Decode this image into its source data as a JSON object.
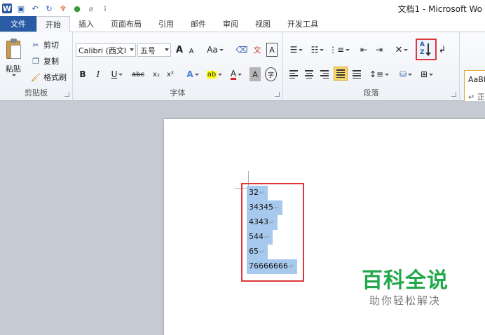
{
  "window": {
    "title": "文档1 - Microsoft Wo",
    "quick_access": [
      "word-app-icon",
      "save-icon",
      "undo-icon",
      "redo-icon",
      "brush-icon",
      "color-icon",
      "eraser-icon",
      "customize-icon"
    ]
  },
  "tabs": [
    {
      "label": "文件"
    },
    {
      "label": "开始"
    },
    {
      "label": "插入"
    },
    {
      "label": "页面布局"
    },
    {
      "label": "引用"
    },
    {
      "label": "邮件"
    },
    {
      "label": "审阅"
    },
    {
      "label": "视图"
    },
    {
      "label": "开发工具"
    }
  ],
  "ribbon": {
    "clipboard": {
      "label": "剪贴板",
      "paste": "粘贴",
      "cut": "剪切",
      "copy": "复制",
      "format_painter": "格式刷"
    },
    "font": {
      "label": "字体",
      "font_name": "Calibri (西文I",
      "font_size": "五号",
      "grow": "A",
      "shrink": "A",
      "case": "Aa",
      "bold": "B",
      "italic": "I",
      "underline": "U",
      "strike": "abc",
      "subscript": "x₂",
      "superscript": "x²",
      "text_effect": "A",
      "highlight": "ab",
      "font_color": "A",
      "char_shading": "A",
      "enclose": "字"
    },
    "paragraph": {
      "label": "段落"
    },
    "styles": {
      "preview": "AaBb",
      "sub": "↵ 正"
    }
  },
  "document": {
    "lines": [
      "32",
      "34345",
      "4343",
      "544",
      "65",
      "76666666"
    ],
    "paragraph_mark": "↵"
  },
  "watermark": {
    "main": "百科全说",
    "sub": "助你轻松解决"
  },
  "colors": {
    "accent": "#2a5ca6",
    "highlight_box": "#e0373b",
    "selection": "#a8c9ee",
    "watermark_green": "#22a84a"
  }
}
